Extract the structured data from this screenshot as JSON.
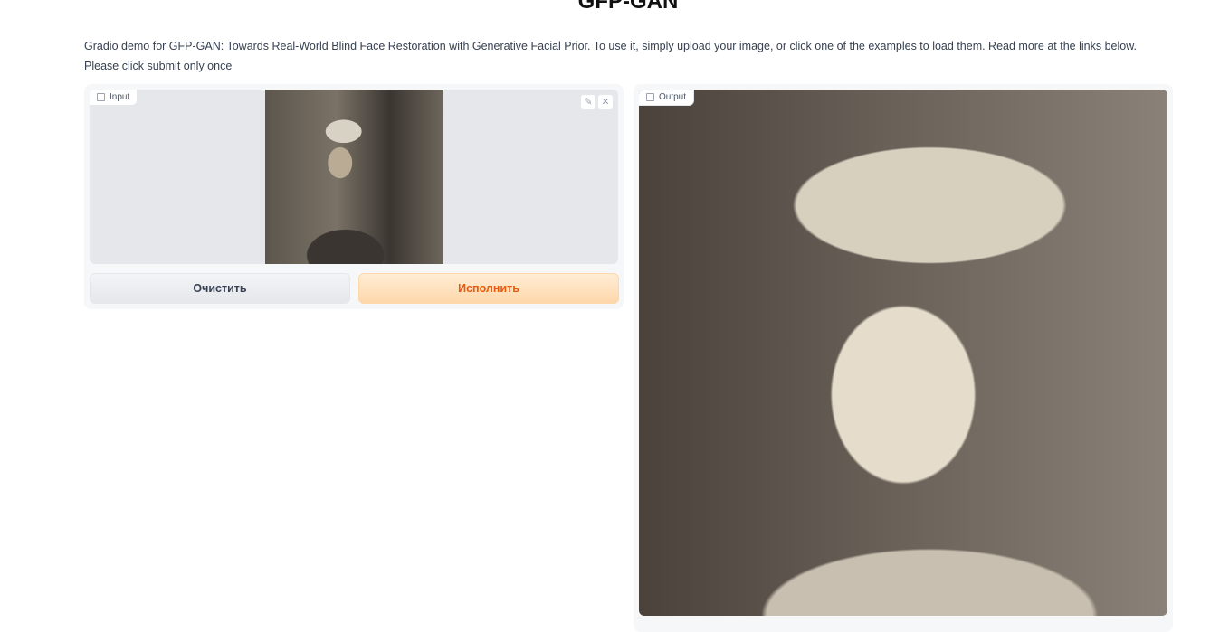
{
  "title": "GFP-GAN",
  "description": "Gradio demo for GFP-GAN: Towards Real-World Blind Face Restoration with Generative Facial Prior. To use it, simply upload your image, or click one of the examples to load them. Read more at the links below. Please click submit only once",
  "input": {
    "label": "Input",
    "edit_icon": "✎",
    "clear_icon": "✕"
  },
  "output": {
    "label": "Output"
  },
  "buttons": {
    "clear": "Очистить",
    "submit": "Исполнить"
  }
}
